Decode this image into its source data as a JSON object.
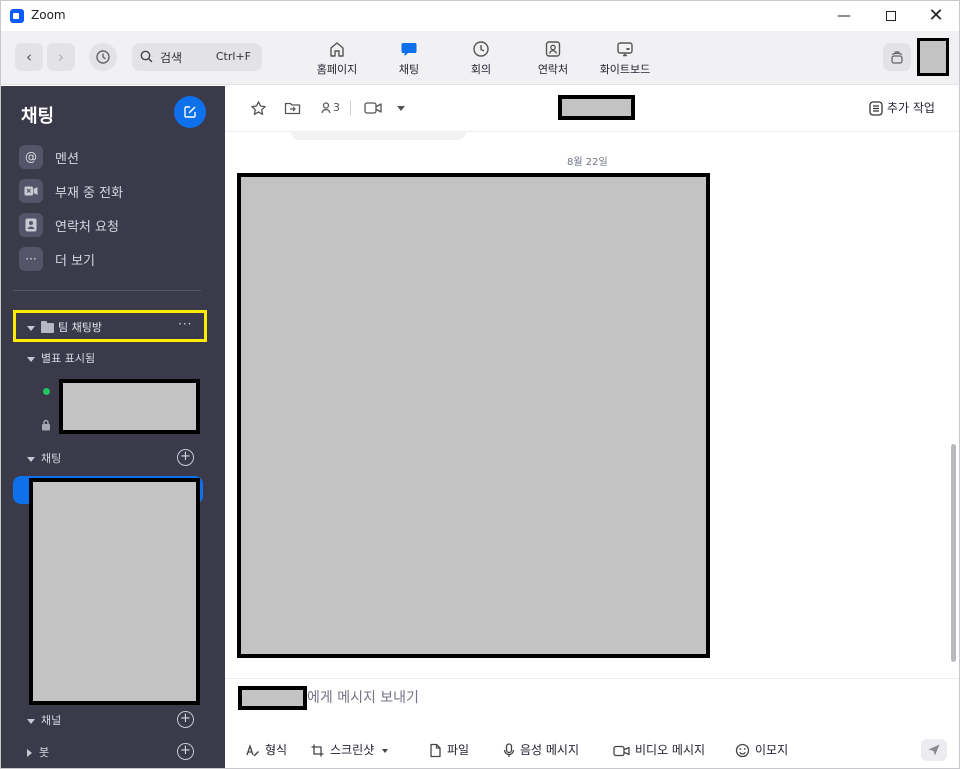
{
  "window": {
    "app_title": "Zoom",
    "controls": {
      "minimize": "—",
      "close": "✕"
    }
  },
  "toolbar": {
    "back_icon": "‹",
    "forward_icon": "›",
    "search": {
      "label": "검색",
      "shortcut": "Ctrl+F"
    },
    "tabs": [
      {
        "label": "홈페이지",
        "icon": "home-icon",
        "active": false
      },
      {
        "label": "채팅",
        "icon": "chat-bubble-icon",
        "active": true
      },
      {
        "label": "회의",
        "icon": "clock-icon",
        "active": false
      },
      {
        "label": "연락처",
        "icon": "contact-card-icon",
        "active": false
      },
      {
        "label": "화이트보드",
        "icon": "whiteboard-icon",
        "active": false
      }
    ]
  },
  "sidebar": {
    "title": "채팅",
    "quick_items": [
      {
        "label": "멘션",
        "icon": "@"
      },
      {
        "label": "부재 중 전화",
        "icon": "missed-call-icon"
      },
      {
        "label": "연락처 요청",
        "icon": "contact-request-icon"
      },
      {
        "label": "더 보기",
        "icon": "···"
      }
    ],
    "folder": {
      "label": "팀 채팅방",
      "more": "···"
    },
    "sections": {
      "starred": "별표 표시됨",
      "chats": "채팅",
      "channels": "채널",
      "bots": "봇"
    },
    "add_symbol": "+"
  },
  "chat": {
    "member_count": "3",
    "more_actions": "추가 작업",
    "date_label": "8월 22일",
    "composer_placeholder": "에게 메시지 보내기",
    "tools": [
      {
        "label": "형식",
        "icon": "format-icon"
      },
      {
        "label": "스크린샷",
        "icon": "screenshot-icon"
      },
      {
        "label": "파일",
        "icon": "file-icon"
      },
      {
        "label": "음성 메시지",
        "icon": "microphone-icon"
      },
      {
        "label": "비디오 메시지",
        "icon": "video-icon"
      },
      {
        "label": "이모지",
        "icon": "emoji-icon"
      }
    ]
  },
  "colors": {
    "accent": "#0e71eb",
    "sidebar_bg": "#3a3a4a",
    "highlight": "#ffec00",
    "online": "#22c55e"
  }
}
